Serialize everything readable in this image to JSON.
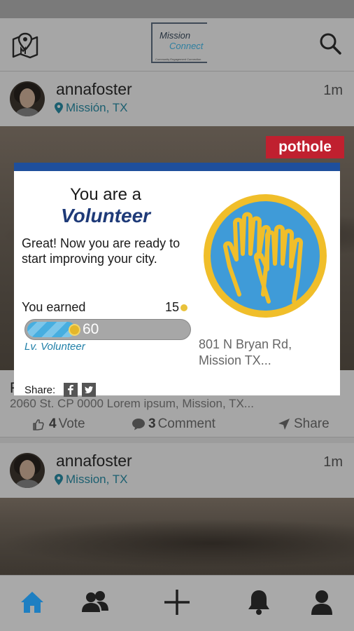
{
  "header": {
    "logo_line1": "Mission",
    "logo_line2": "Connect",
    "logo_tagline": "Community Engagement Connection"
  },
  "posts": [
    {
      "username": "annafoster",
      "location": "Missión, TX",
      "time": "1m",
      "tag": "pothole",
      "title": "P",
      "address": "2060 St. CP 0000 Lorem ipsum, Mission, TX...",
      "votes": {
        "count": "4",
        "label": "Vote"
      },
      "comments": {
        "count": "3",
        "label": "Comment"
      },
      "share_label": "Share"
    },
    {
      "username": "annafoster",
      "location": "Mission, TX",
      "time": "1m"
    }
  ],
  "modal": {
    "title_line1": "You are a",
    "title_line2": "Volunteer",
    "message": "Great! Now you are ready to start improving your city.",
    "earned_label": "You earned",
    "earned_points": "15",
    "progress_value": "60",
    "progress_fraction": 0.3,
    "level_label": "Lv. Volunteer",
    "address": "801 N Bryan Rd, Mission TX...",
    "share_label": "Share:"
  },
  "colors": {
    "accent": "#1e4f9c",
    "tag": "#c0202f",
    "badge_blue": "#3f9bd8",
    "badge_gold": "#f0be2a"
  },
  "tabs": [
    "home-icon",
    "friends-icon",
    "add-icon",
    "bell-icon",
    "profile-icon"
  ]
}
